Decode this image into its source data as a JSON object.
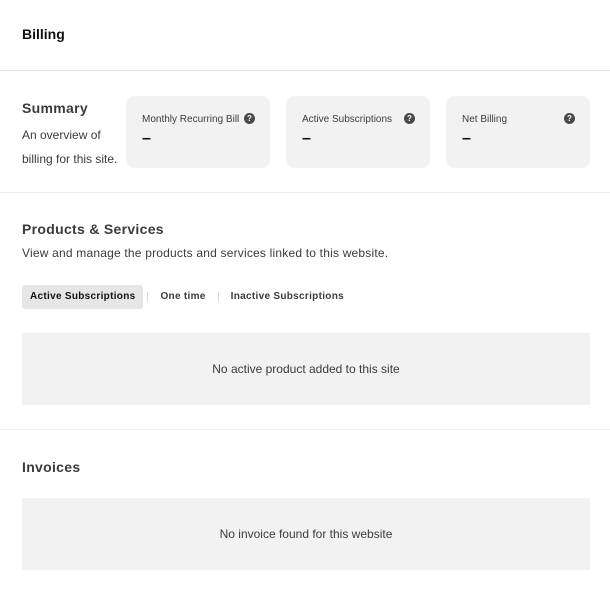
{
  "header": {
    "title": "Billing"
  },
  "summary": {
    "title": "Summary",
    "description": "An overview of billing for this site.",
    "cards": [
      {
        "label": "Monthly Recurring Bill",
        "value": "–",
        "help_icon": "question-circle-icon"
      },
      {
        "label": "Active Subscriptions",
        "value": "–",
        "help_icon": "question-circle-icon"
      },
      {
        "label": "Net Billing",
        "value": "–",
        "help_icon": "question-circle-icon"
      }
    ]
  },
  "products": {
    "title": "Products & Services",
    "description": "View and manage the products and services linked to this website.",
    "tabs": [
      {
        "label": "Active Subscriptions",
        "active": true
      },
      {
        "label": "One time",
        "active": false
      },
      {
        "label": "Inactive Subscriptions",
        "active": false
      }
    ],
    "empty_message": "No active product added to this site"
  },
  "invoices": {
    "title": "Invoices",
    "empty_message": "No invoice found for this website"
  },
  "colors": {
    "card_background": "#f2f2f2",
    "active_tab_background": "#e6e6e6",
    "text": "#3b3b3b",
    "divider": "#e2e2e2"
  }
}
